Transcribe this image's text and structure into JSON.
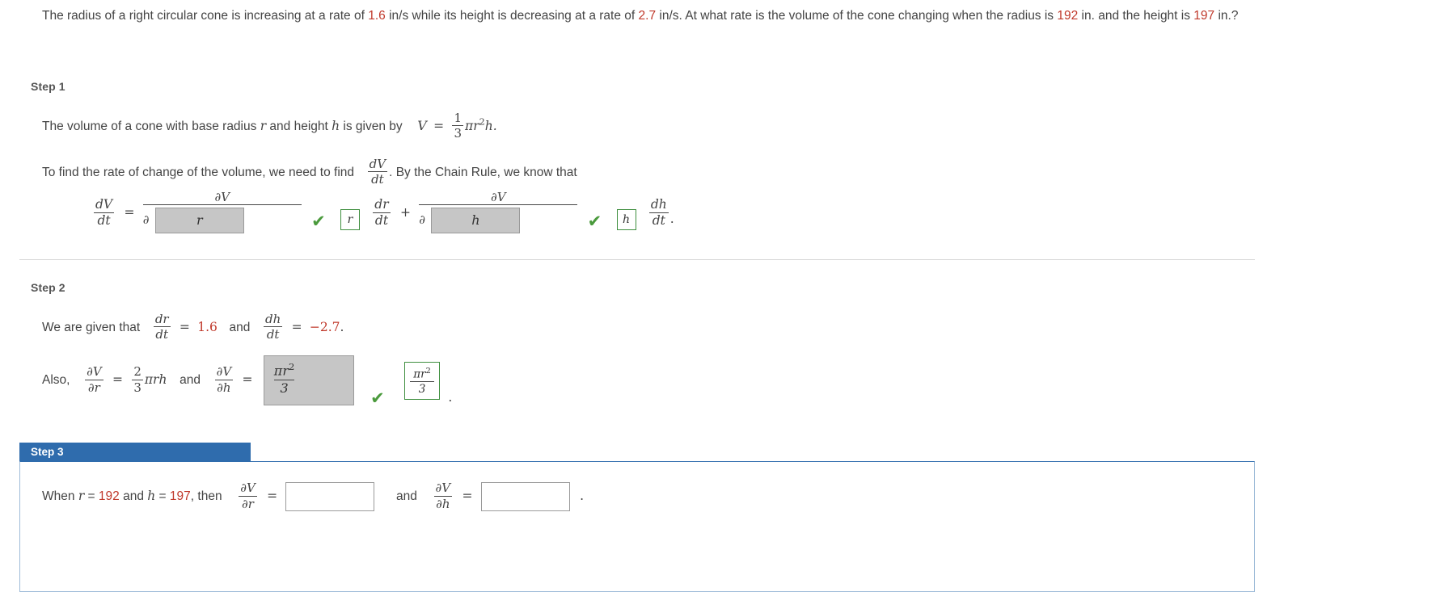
{
  "problem": {
    "text_1": "The radius of a right circular cone is increasing at a rate of ",
    "rate_radius": "1.6",
    "text_2": " in/s while its height is decreasing at a rate of ",
    "rate_height": "2.7",
    "text_3": " in/s. At what rate is the volume of the cone changing when the radius is ",
    "radius_value": "192",
    "text_4": " in. and the height is ",
    "height_value": "197",
    "text_5": " in.?"
  },
  "step1": {
    "label": "Step 1",
    "volume_sentence_a": "The volume of a cone with base radius ",
    "volume_var_r": "r",
    "volume_sentence_b": " and height ",
    "volume_var_h": "h",
    "volume_sentence_c": " is given by",
    "V": "V",
    "equals": "=",
    "frac_num": "1",
    "frac_den": "3",
    "pi_r_h": "πr",
    "exp_2": "2",
    "h_tail": "h.",
    "chain_sentence_a": "To find the rate of change of the volume, we need to find",
    "dV": "dV",
    "dt": "dt",
    "chain_sentence_b": ".  By the Chain Rule, we know that",
    "eq": {
      "lhs_num": "dV",
      "lhs_den": "dt",
      "equals": "=",
      "partial_V_1": "∂V",
      "partial_sym_1": "∂",
      "answer_box_1": "r",
      "chip_1": "r",
      "dr_num": "dr",
      "dr_den": "dt",
      "plus": "+",
      "partial_V_2": "∂V",
      "partial_sym_2": "∂",
      "answer_box_2": "h",
      "chip_2": "h",
      "dh_num": "dh",
      "dh_den": "dt",
      "period": "."
    }
  },
  "step2": {
    "label": "Step 2",
    "given_a": "We are given that",
    "dr_num": "dr",
    "dr_den": "dt",
    "eq1": "=",
    "dr_value": "1.6",
    "and": "and",
    "dh_num": "dh",
    "dh_den": "dt",
    "eq2": "=",
    "dh_value": "−2.7",
    "period": ".",
    "also": "Also,",
    "pV_num_1": "∂V",
    "pV_den_1": "∂r",
    "eq3": "=",
    "two": "2",
    "three": "3",
    "pirh": "πrh",
    "and2": "and",
    "pV_num_2": "∂V",
    "pV_den_2": "∂h",
    "eq4": "=",
    "box_numer": "πr",
    "box_exp": "2",
    "box_denom": "3",
    "chip_numer": "πr",
    "chip_exp": "2",
    "chip_denom": "3",
    "period2": "."
  },
  "step3": {
    "label": "Step 3",
    "when": "When ",
    "var_r": "r",
    "eq_r": " = ",
    "r_value": "192",
    "and_txt": " and ",
    "var_h": "h",
    "eq_h": " = ",
    "h_value": "197",
    "then": ", then",
    "pV_num_1": "∂V",
    "pV_den_1": "∂r",
    "equals_1": "=",
    "input_1": "",
    "and_2": "and",
    "pV_num_2": "∂V",
    "pV_den_2": "∂h",
    "equals_2": "=",
    "input_2": "",
    "period": "."
  },
  "colors": {
    "accent_blue": "#2f6cad",
    "number_red": "#c0392b",
    "check_green": "#4a9a3c",
    "box_grey": "#c6c6c6"
  }
}
